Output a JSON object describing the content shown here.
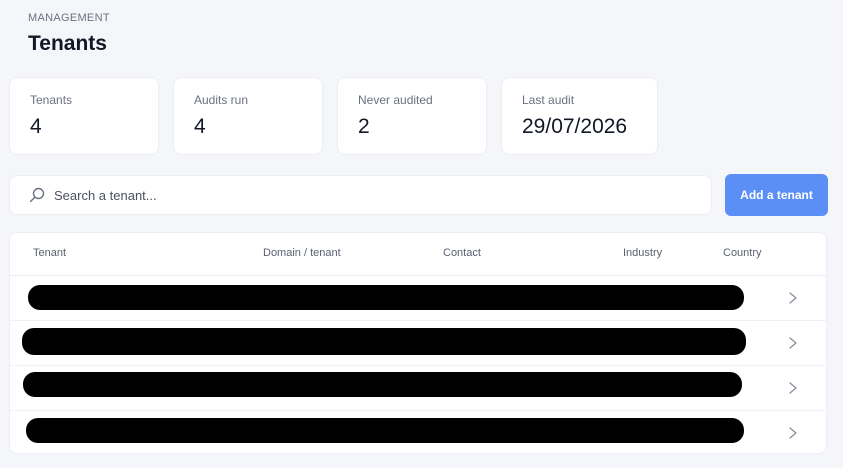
{
  "header": {
    "eyebrow": "MANAGEMENT",
    "title": "Tenants"
  },
  "stats": [
    {
      "label": "Tenants",
      "value": "4"
    },
    {
      "label": "Audits run",
      "value": "4"
    },
    {
      "label": "Never audited",
      "value": "2"
    },
    {
      "label": "Last audit",
      "value": "29/07/2026"
    }
  ],
  "search": {
    "placeholder": "Search a tenant...",
    "icon": "search-icon"
  },
  "toolbar": {
    "add_label": "Add a tenant",
    "add_color": "#5b8ff5"
  },
  "table": {
    "columns": [
      "Tenant",
      "Domain / tenant",
      "Contact",
      "Industry",
      "Country"
    ],
    "rows": [
      {
        "redacted": true,
        "action_icon": "chevron-right-icon"
      },
      {
        "redacted": true,
        "action_icon": "chevron-right-icon"
      },
      {
        "redacted": true,
        "action_icon": "chevron-right-icon"
      },
      {
        "redacted": true,
        "action_icon": "chevron-right-icon"
      }
    ]
  }
}
